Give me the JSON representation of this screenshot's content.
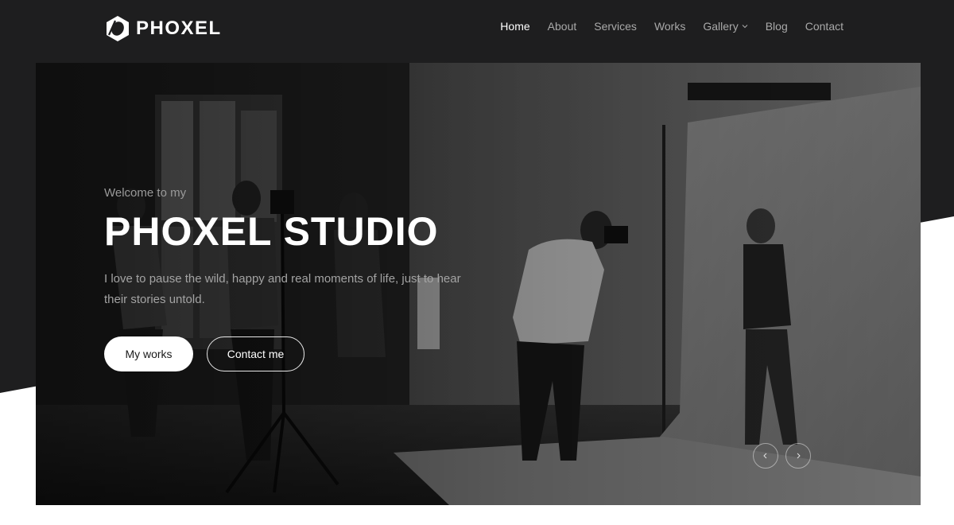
{
  "brand": {
    "name": "PHOXEL",
    "logo_icon": "hexagon-ring-logo-icon"
  },
  "nav": {
    "items": [
      {
        "label": "Home",
        "active": true
      },
      {
        "label": "About"
      },
      {
        "label": "Services"
      },
      {
        "label": "Works"
      },
      {
        "label": "Gallery",
        "icon": "chevron-down-icon"
      },
      {
        "label": "Blog"
      },
      {
        "label": "Contact"
      }
    ]
  },
  "hero": {
    "welcome": "Welcome to my",
    "title": "PHOXEL STUDIO",
    "description": "I love to pause the wild, happy and real moments of life, just to hear their stories untold.",
    "primary_button": "My works",
    "secondary_button": "Contact me",
    "prev_icon": "chevron-left-icon",
    "next_icon": "chevron-right-icon"
  },
  "colors": {
    "background": "#1e1e1f",
    "accent": "#ffffff",
    "nav_text": "#a9a9a9"
  }
}
